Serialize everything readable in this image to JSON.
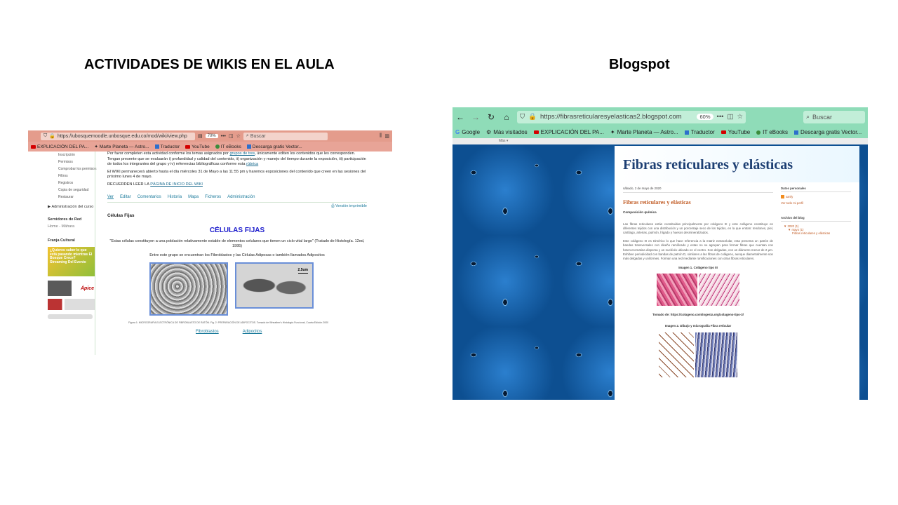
{
  "slide": {
    "title_left": "ACTIVIDADES DE WIKIS EN EL AULA",
    "title_right": "Blogspot"
  },
  "left_browser": {
    "url": "https://ubosquemoodle.unbosque.edu.co/mod/wiki/view.php",
    "zoom": "70%",
    "search_placeholder": "Buscar",
    "bookmarks": [
      "EXPLICACIÓN DEL PA...",
      "Marte Planeta — Astro...",
      "Traductor",
      "YouTube",
      "IT eBooks",
      "Descarga gratis Vector..."
    ],
    "sidebar": {
      "items": [
        "Inscripción",
        "Permisos",
        "Comprobar los permisos",
        "Filtros",
        "Registros",
        "Copia de seguridad",
        "Restaurar"
      ],
      "admin": "▶ Administración del curso",
      "servers_head": "Servidores de Red",
      "servers_item": "Home - Máhara",
      "franja_head": "Franja Cultural",
      "promo_text": "¿Quieres saber lo que está pasando mientras El Bosque Crece? Streaming Del Evento",
      "promo2_text": "Ápice"
    },
    "main": {
      "para1_a": "Por favor completen esta actividad conforme los temas asignados por ",
      "para1_link": "grupos de tres",
      "para1_b": ", únicamente editen los contenidos que les corresponden. Tengan presente que se evaluarán i) profundidad y calidad del contenido, ii) organización y manejo del tiempo durante la exposición, iii) participación de todos los integrantes del grupo y iv) referencias bibliográficas conforme esta ",
      "para1_link2": "rúbrica",
      "para2": "El WIKI permanecerá abierto hasta el día miércoles 31 de Mayo a las 11:55 pm y haremos exposiciones del contenido que creen en las sesiones del próximo lunes 4 de mayo.",
      "para3_a": "RECUERDEN LEER LA ",
      "para3_link": "PÁGINA DE INICIO DEL WIKI",
      "tabs": [
        "Ver",
        "Editar",
        "Comentarios",
        "Historia",
        "Mapa",
        "Ficheros",
        "Administración"
      ],
      "print": "Versión imprimible",
      "section": "Células Fijas",
      "heading": "CÉLULAS FIJAS",
      "quote": "\"Estas células constituyen a una población relativamente estable de elementos celulares que tienen un ciclo vital largo\" (Tratado de Histología. 12ed, 1995)",
      "intro": "Entre este grupo se encuentran los Fibroblastos y las Células Adiposas o también llamados Adipocitos",
      "scale": "2.5um",
      "figure_caption": "Figura 1: MICROGRAFÍA ELECTRÓNICA DE FIBROBLASTO DE RATÓN. Fig. 2: PREPARACIÓN DE ADIPOCITOS. Tomado de Wheather's Histología Funcional, Cuarta Edición 2000",
      "link_a": "Fibroblastos",
      "link_b": "Adipocitos"
    }
  },
  "right_browser": {
    "url": "https://fibrasreticularesyelasticas2.blogspot.com",
    "zoom": "60%",
    "search_placeholder": "Buscar",
    "bookmarks": [
      "Google",
      "Más visitados",
      "EXPLICACIÓN DEL PA...",
      "Marte Planeta — Astro...",
      "Traductor",
      "YouTube",
      "IT eBooks",
      "Descarga gratis Vector..."
    ],
    "blogger_bar": "Más ▾",
    "blog": {
      "title": "Fibras reticulares y elásticas",
      "date": "sábado, 2 de mayo de 2020",
      "post_title": "Fibras reticulares y elásticas",
      "post_sub": "Composición química",
      "para1": "Las fibras reticulares están constituidas principalmente por colágeno III y este colágeno constituye en diferentes tejidos con una distribución y un porcentaje seco de los tejidos, en la que entran: tendones, piel, cartílago, arterias, pulmón, hígado y huesos desmineralizados.",
      "para2": "Este colágeno III es trimérico lo que hace referencia a la matriz extracelular, esta presenta un patrón de bandas transversales con diseño ramificado y estas no se agrupan para formar fibras que cuentan con heterocromatina dispersa y un nucléolo ubicado en el centro. Son delgadas, con un diámetro menor de 2 μm. Exhiben periodicidad con bandas de patrón D, similares a las fibras de colágeno, aunque diametralmente son más delgadas y uniformes. Forman una red mediante ramificaciones con otras fibras reticulares.",
      "img1_caption": "Imagen 1. Colágeno tipo III",
      "source": "Tomado de: https://colageno.com/ingesta.org/colageno-tipo-3/",
      "img2_caption": "Imagen 2. Dibujo y micrografía Fibra reticular"
    },
    "sidebar": {
      "personal_head": "Datos personales",
      "author": "sanfy",
      "profile_link": "Ver todo mi perfil",
      "archive_head": "Archivo del blog",
      "year": "▼ 2020 (1)",
      "month": "▼ mayo (1)",
      "post": "Fibras reticulares y elásticas"
    }
  }
}
